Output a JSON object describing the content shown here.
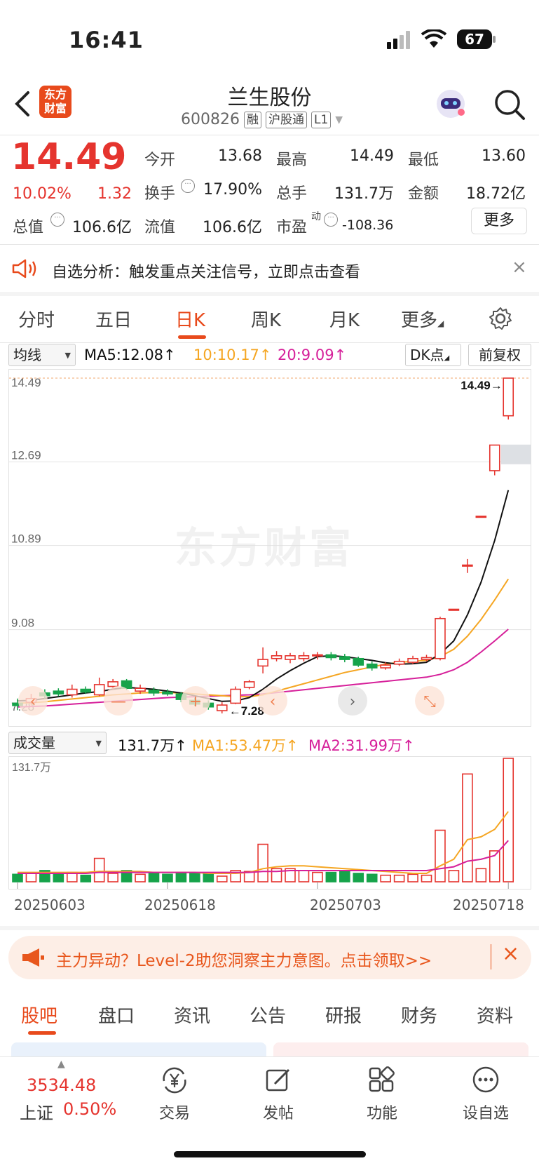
{
  "status": {
    "time": "16:41",
    "battery": "67"
  },
  "header": {
    "title": "兰生股份",
    "code": "600826",
    "tags": [
      "融",
      "沪股通",
      "L1"
    ],
    "logo_text": "东方财富"
  },
  "quote": {
    "price": "14.49",
    "change_pct": "10.02%",
    "change": "1.32",
    "open_label": "今开",
    "open": "13.68",
    "high_label": "最高",
    "high": "14.49",
    "low_label": "最低",
    "low": "13.60",
    "turnover_label": "换手",
    "turnover": "17.90%",
    "volume_label": "总手",
    "volume": "131.7万",
    "amount_label": "金额",
    "amount": "18.72亿",
    "mcap_label": "总值",
    "mcap": "106.6亿",
    "float_label": "流值",
    "float": "106.6亿",
    "pe_label": "市盈",
    "pe_sup": "动",
    "pe": "-108.36",
    "more": "更多"
  },
  "notice": {
    "text": "自选分析：触发重点关注信号，立即点击查看"
  },
  "tabs": [
    "分时",
    "五日",
    "日K",
    "周K",
    "月K",
    "更多"
  ],
  "ma_row": {
    "selector": "均线",
    "ma5": "MA5:12.08",
    "ma10": "10:10.17",
    "ma20": "20:9.09",
    "dk": "DK点",
    "fq": "前复权"
  },
  "vol_row": {
    "selector": "成交量",
    "vol": "131.7万",
    "ma1": "MA1:53.47万",
    "ma2": "MA2:31.99万"
  },
  "chart_data": {
    "type": "candlestick",
    "y_ticks": [
      "14.49",
      "12.69",
      "10.89",
      "9.08",
      "7.28"
    ],
    "ylim": [
      7.28,
      14.49
    ],
    "max_label": "14.49",
    "min_label": "7.28",
    "x_ticks": [
      "20250603",
      "20250618",
      "20250703",
      "20250718"
    ],
    "vol_top_label": "131.7万",
    "candles": [
      {
        "o": 7.5,
        "c": 7.45,
        "h": 7.6,
        "l": 7.35,
        "v": 8
      },
      {
        "o": 7.52,
        "c": 7.6,
        "h": 7.7,
        "l": 7.45,
        "v": 9
      },
      {
        "o": 7.72,
        "c": 7.66,
        "h": 7.8,
        "l": 7.6,
        "v": 12
      },
      {
        "o": 7.76,
        "c": 7.7,
        "h": 7.82,
        "l": 7.65,
        "v": 9
      },
      {
        "o": 7.68,
        "c": 7.8,
        "h": 7.9,
        "l": 7.62,
        "v": 10
      },
      {
        "o": 7.8,
        "c": 7.74,
        "h": 7.86,
        "l": 7.7,
        "v": 7
      },
      {
        "o": 7.68,
        "c": 7.9,
        "h": 8.05,
        "l": 7.65,
        "v": 25
      },
      {
        "o": 7.86,
        "c": 7.96,
        "h": 8.02,
        "l": 7.8,
        "v": 9
      },
      {
        "o": 7.98,
        "c": 7.82,
        "h": 8.02,
        "l": 7.78,
        "v": 12
      },
      {
        "o": 7.76,
        "c": 7.82,
        "h": 7.9,
        "l": 7.7,
        "v": 8
      },
      {
        "o": 7.78,
        "c": 7.72,
        "h": 7.84,
        "l": 7.66,
        "v": 9
      },
      {
        "o": 7.74,
        "c": 7.7,
        "h": 7.8,
        "l": 7.66,
        "v": 8
      },
      {
        "o": 7.7,
        "c": 7.58,
        "h": 7.74,
        "l": 7.52,
        "v": 10
      },
      {
        "o": 7.56,
        "c": 7.48,
        "h": 7.62,
        "l": 7.44,
        "v": 9
      },
      {
        "o": 7.5,
        "c": 7.42,
        "h": 7.56,
        "l": 7.36,
        "v": 8
      },
      {
        "o": 7.34,
        "c": 7.46,
        "h": 7.52,
        "l": 7.28,
        "v": 6
      },
      {
        "o": 7.5,
        "c": 7.8,
        "h": 7.86,
        "l": 7.48,
        "v": 12
      },
      {
        "o": 7.84,
        "c": 7.96,
        "h": 8.0,
        "l": 7.8,
        "v": 11
      },
      {
        "o": 8.3,
        "c": 8.44,
        "h": 8.7,
        "l": 8.14,
        "v": 40
      },
      {
        "o": 8.46,
        "c": 8.52,
        "h": 8.62,
        "l": 8.4,
        "v": 14
      },
      {
        "o": 8.44,
        "c": 8.52,
        "h": 8.58,
        "l": 8.36,
        "v": 14
      },
      {
        "o": 8.46,
        "c": 8.52,
        "h": 8.6,
        "l": 8.4,
        "v": 12
      },
      {
        "o": 8.52,
        "c": 8.54,
        "h": 8.6,
        "l": 8.44,
        "v": 10
      },
      {
        "o": 8.54,
        "c": 8.48,
        "h": 8.6,
        "l": 8.42,
        "v": 10
      },
      {
        "o": 8.5,
        "c": 8.44,
        "h": 8.56,
        "l": 8.38,
        "v": 11
      },
      {
        "o": 8.46,
        "c": 8.32,
        "h": 8.5,
        "l": 8.28,
        "v": 9
      },
      {
        "o": 8.34,
        "c": 8.26,
        "h": 8.4,
        "l": 8.2,
        "v": 8
      },
      {
        "o": 8.26,
        "c": 8.32,
        "h": 8.38,
        "l": 8.22,
        "v": 7
      },
      {
        "o": 8.34,
        "c": 8.4,
        "h": 8.46,
        "l": 8.3,
        "v": 7
      },
      {
        "o": 8.38,
        "c": 8.46,
        "h": 8.52,
        "l": 8.34,
        "v": 8
      },
      {
        "o": 8.44,
        "c": 8.48,
        "h": 8.54,
        "l": 8.4,
        "v": 7
      },
      {
        "o": 8.46,
        "c": 9.32,
        "h": 9.36,
        "l": 8.42,
        "v": 55
      },
      {
        "o": 9.52,
        "c": 9.52,
        "h": 9.52,
        "l": 9.52,
        "v": 12
      },
      {
        "o": 10.47,
        "c": 10.47,
        "h": 10.6,
        "l": 10.3,
        "v": 115
      },
      {
        "o": 11.52,
        "c": 11.52,
        "h": 11.52,
        "l": 11.52,
        "v": 14
      },
      {
        "o": 12.5,
        "c": 13.05,
        "h": 13.05,
        "l": 12.4,
        "v": 33
      },
      {
        "o": 13.68,
        "c": 14.49,
        "h": 14.49,
        "l": 13.6,
        "v": 131.7
      }
    ],
    "ma5": [
      7.55,
      7.56,
      7.6,
      7.64,
      7.68,
      7.72,
      7.75,
      7.8,
      7.84,
      7.82,
      7.8,
      7.76,
      7.72,
      7.66,
      7.6,
      7.54,
      7.55,
      7.62,
      7.8,
      8.02,
      8.2,
      8.36,
      8.5,
      8.52,
      8.5,
      8.46,
      8.42,
      8.37,
      8.34,
      8.35,
      8.38,
      8.56,
      8.84,
      9.4,
      10.1,
      11.0,
      12.08
    ],
    "ma10": [
      7.5,
      7.51,
      7.53,
      7.56,
      7.59,
      7.62,
      7.65,
      7.68,
      7.7,
      7.72,
      7.73,
      7.73,
      7.72,
      7.7,
      7.68,
      7.66,
      7.64,
      7.64,
      7.68,
      7.76,
      7.84,
      7.92,
      8.0,
      8.08,
      8.16,
      8.22,
      8.28,
      8.34,
      8.38,
      8.4,
      8.42,
      8.5,
      8.66,
      8.94,
      9.3,
      9.72,
      10.17
    ],
    "ma20": [
      7.42,
      7.43,
      7.44,
      7.46,
      7.48,
      7.5,
      7.52,
      7.54,
      7.56,
      7.58,
      7.6,
      7.62,
      7.63,
      7.64,
      7.65,
      7.66,
      7.67,
      7.68,
      7.7,
      7.73,
      7.76,
      7.79,
      7.82,
      7.85,
      7.88,
      7.91,
      7.94,
      7.97,
      8.0,
      8.03,
      8.06,
      8.12,
      8.22,
      8.38,
      8.6,
      8.84,
      9.09
    ],
    "vol_ma1": [
      10,
      10,
      10,
      10,
      10,
      10,
      11,
      11,
      11,
      11,
      10,
      10,
      10,
      10,
      9,
      9,
      9,
      10,
      14,
      16,
      17,
      17,
      16,
      15,
      14,
      13,
      12,
      11,
      10,
      9,
      9,
      17,
      24,
      45,
      48,
      56,
      75
    ],
    "vol_ma2": [
      9,
      9,
      9,
      9,
      9,
      9,
      10,
      10,
      10,
      10,
      10,
      10,
      10,
      10,
      10,
      10,
      10,
      10,
      11,
      11,
      12,
      12,
      12,
      12,
      12,
      12,
      12,
      12,
      12,
      12,
      12,
      14,
      16,
      22,
      24,
      28,
      44
    ]
  },
  "banner": {
    "text": "主力异动？Level-2助您洞察主力意图。点击领取>>"
  },
  "subtabs": [
    "股吧",
    "盘口",
    "资讯",
    "公告",
    "研报",
    "财务",
    "资料"
  ],
  "bottom": {
    "index_value": "3534.48",
    "index_name": "上证",
    "index_pct": "0.50%",
    "nav": [
      "交易",
      "发帖",
      "功能",
      "设自选"
    ]
  },
  "colors": {
    "up": "#e5342e",
    "down": "#16a34a",
    "accent": "#e84a1c",
    "ma5": "#111111",
    "ma10": "#f5a623",
    "ma20": "#d6209a"
  }
}
